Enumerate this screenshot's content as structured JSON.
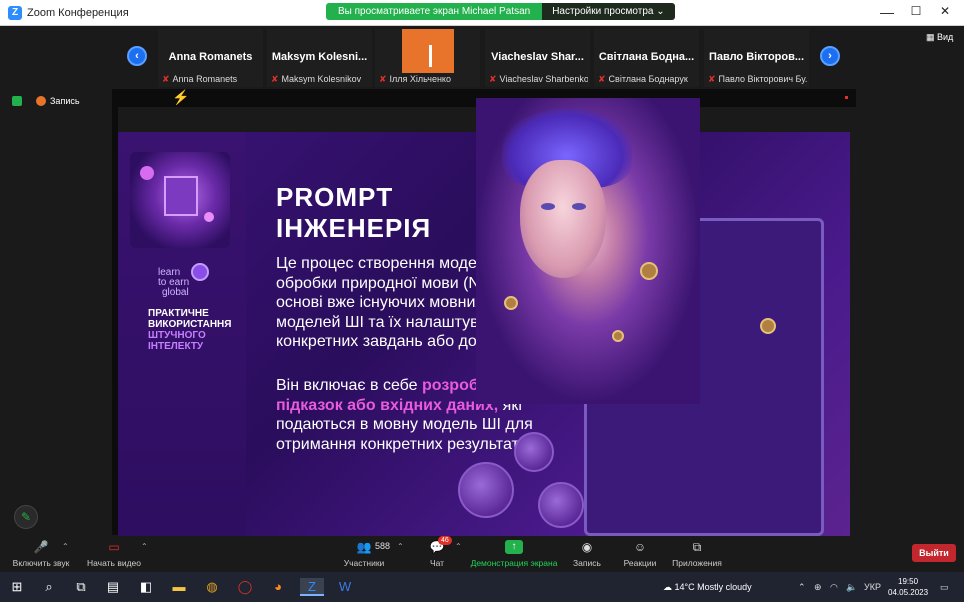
{
  "window": {
    "title": "Zoom Конференция",
    "share_banner": "Вы просматриваете экран Michael Patsan",
    "view_settings": "Настройки просмотра",
    "view_settings_caret": "⌄",
    "minimize": "—",
    "maximize": "☐",
    "close": "✕"
  },
  "gallery": {
    "prev": "‹",
    "next": "›",
    "view_label": "Вид",
    "tiles": [
      {
        "big": "Anna Romanets",
        "small": "Anna Romanets"
      },
      {
        "big": "Maksym Kolesni...",
        "small": "Maksym Kolesnikov"
      },
      {
        "big": "",
        "small": "Ілля Хільченко"
      },
      {
        "big": "Viacheslav Shar...",
        "small": "Viacheslav Sharbenko"
      },
      {
        "big": "Світлана Бодна...",
        "small": "Світлана Боднарук"
      },
      {
        "big": "Павло Вікторов...",
        "small": "Павло Вікторович Бу..."
      }
    ]
  },
  "recording": {
    "label": "Запись"
  },
  "slide": {
    "course_label_white": "ПРАКТИЧНЕ ВИКОРИСТАННЯ",
    "course_label_purple": "ШТУЧНОГО ІНТЕЛЕКТУ",
    "logo_line1": "learn",
    "logo_line2": "to earn",
    "logo_line3": "global",
    "heading": "PROMPT ІНЖЕНЕРІЯ",
    "paragraph1": "Це процес створення моделей обробки природної мови (NLP) на основі вже існуючих мовних моделей ШІ та їх налаштування для конкретних завдань або додатків.",
    "paragraph2_pre": "Він включає в себе ",
    "paragraph2_highlight": "розробку підказок або вхідних даних,",
    "paragraph2_post": " які подаються в мовну модель ШІ для отримання конкретних результатів."
  },
  "toolbar": {
    "mute": "Включить звук",
    "video": "Начать видео",
    "participants": "Участники",
    "participants_count": "588",
    "chat": "Чат",
    "chat_badge": "46",
    "share": "Демонстрация экрана",
    "record": "Запись",
    "reactions": "Реакции",
    "apps": "Приложения",
    "exit": "Выйти"
  },
  "taskbar": {
    "weather": "14°C  Mostly cloudy",
    "lang": "УКР",
    "time": "19:50",
    "date": "04.05.2023"
  },
  "colors": {
    "zoom_blue": "#2d8cff",
    "share_green": "#22b14c",
    "exit_red": "#c1272d",
    "slide_highlight": "#e75bdc",
    "slide_bg": "#3a1478"
  }
}
